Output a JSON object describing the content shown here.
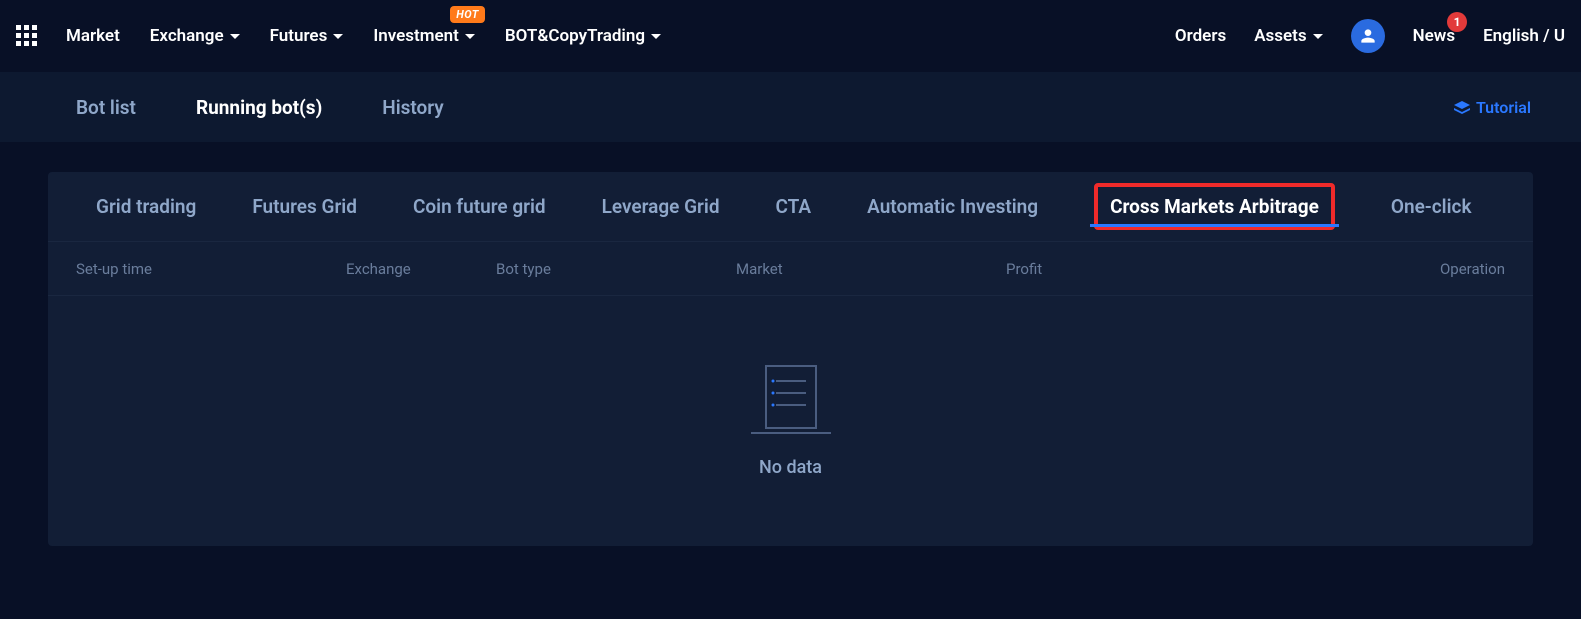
{
  "topnav": {
    "items": [
      {
        "label": "Market",
        "dropdown": false
      },
      {
        "label": "Exchange",
        "dropdown": true
      },
      {
        "label": "Futures",
        "dropdown": true
      },
      {
        "label": "Investment",
        "dropdown": true,
        "badge": "HOT"
      },
      {
        "label": "BOT&CopyTrading",
        "dropdown": true
      }
    ],
    "right": {
      "orders": "Orders",
      "assets": "Assets",
      "news": "News",
      "news_count": "1",
      "language": "English / U"
    }
  },
  "subnav": {
    "tabs": [
      {
        "label": "Bot list",
        "active": false
      },
      {
        "label": "Running bot(s)",
        "active": true
      },
      {
        "label": "History",
        "active": false
      }
    ],
    "tutorial": "Tutorial"
  },
  "bot_tabs": [
    {
      "label": "Grid trading"
    },
    {
      "label": "Futures Grid"
    },
    {
      "label": "Coin future grid"
    },
    {
      "label": "Leverage Grid"
    },
    {
      "label": "CTA"
    },
    {
      "label": "Automatic Investing"
    },
    {
      "label": "Cross Markets Arbitrage",
      "active": true,
      "highlighted": true
    },
    {
      "label": "One-click"
    }
  ],
  "table": {
    "headers": {
      "setup": "Set-up time",
      "exchange": "Exchange",
      "bottype": "Bot type",
      "market": "Market",
      "profit": "Profit",
      "operation": "Operation"
    },
    "empty_text": "No data"
  }
}
